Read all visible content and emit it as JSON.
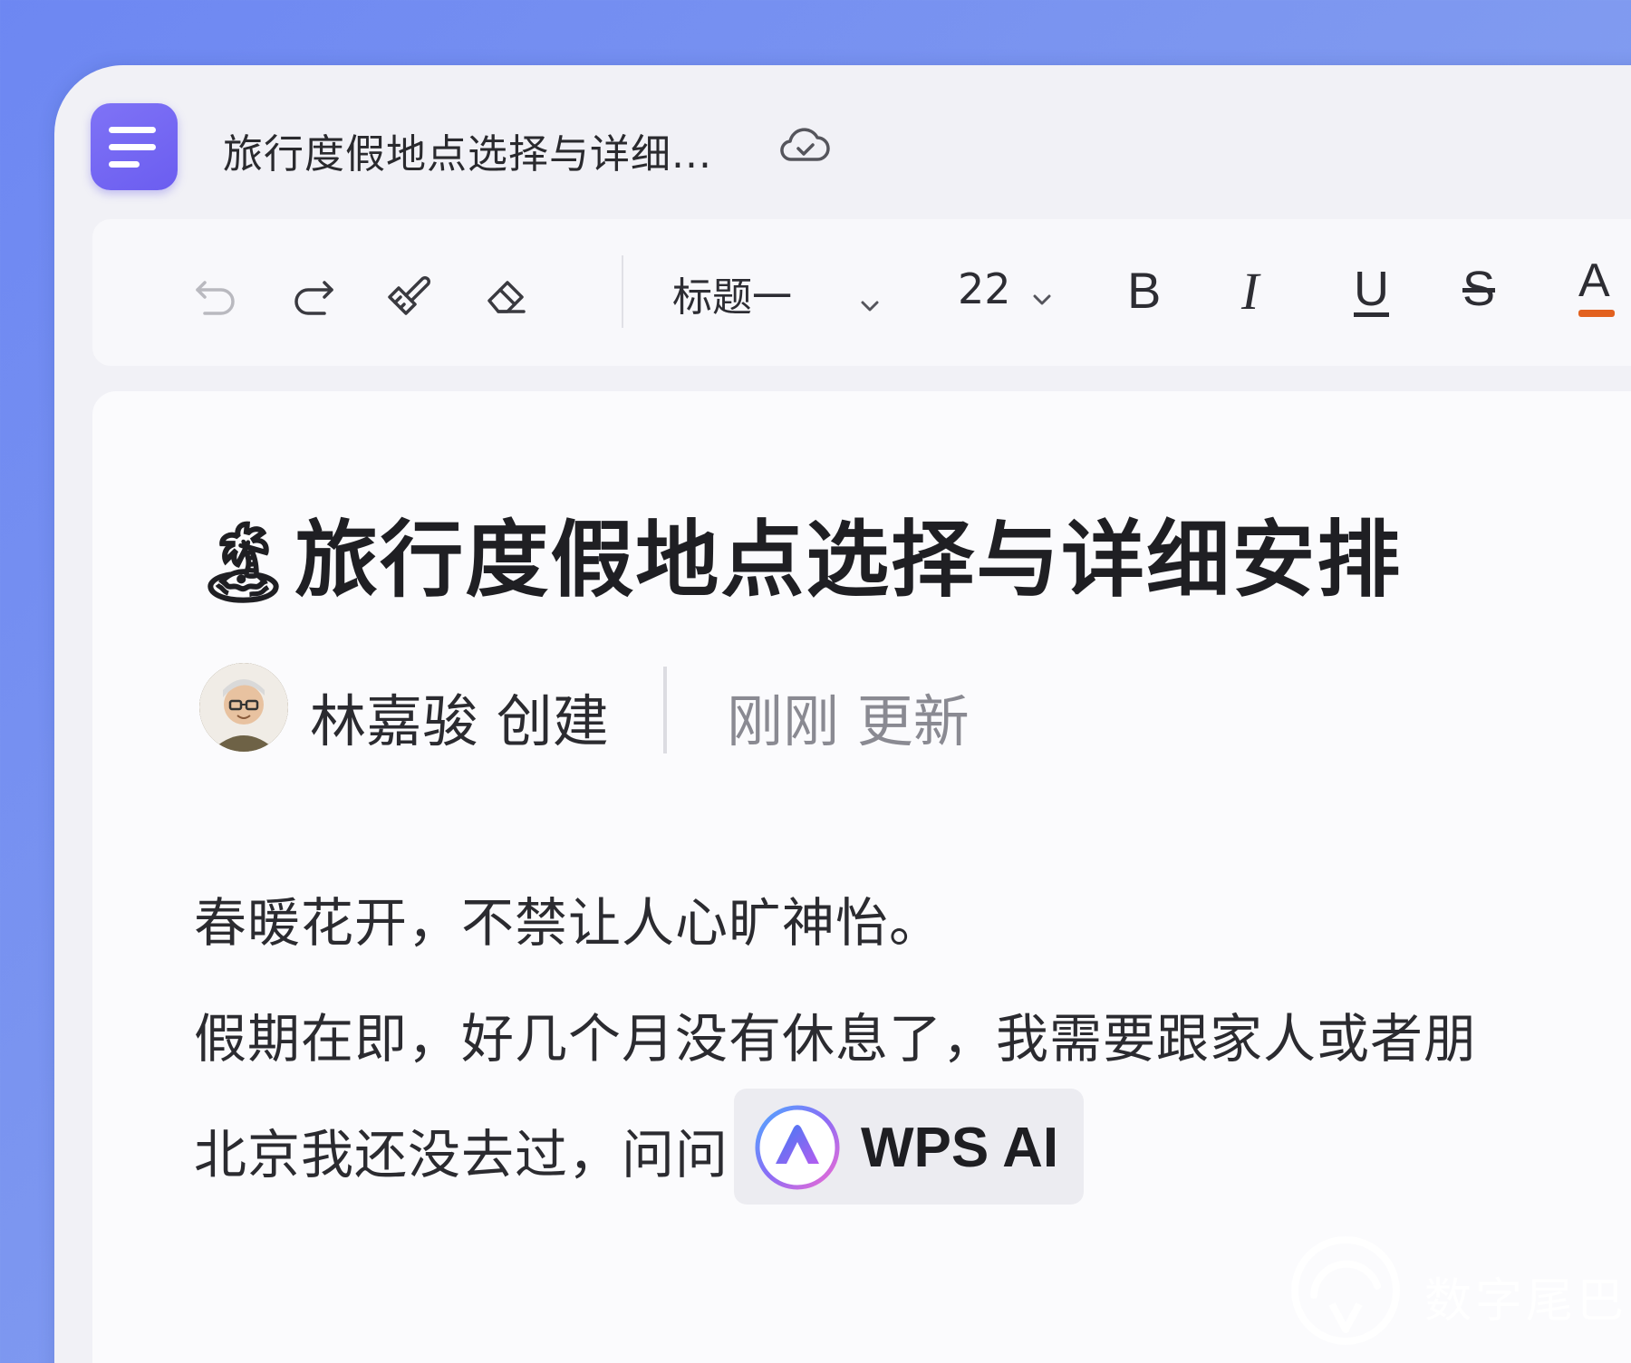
{
  "window": {
    "tab_title": "旅行度假地点选择与详细...",
    "app_icon": "document-lines-icon",
    "sync_icon": "cloud-check-icon"
  },
  "toolbar": {
    "undo_icon": "undo-icon",
    "redo_icon": "redo-icon",
    "format_painter_icon": "format-painter-icon",
    "eraser_icon": "eraser-icon",
    "paragraph_style": "标题一",
    "font_size": "22",
    "bold": "B",
    "italic": "I",
    "underline": "U",
    "strikethrough": "S",
    "font_color_letter": "A",
    "font_color": "#e2611f"
  },
  "document": {
    "title_emoji": "🏝",
    "title": "旅行度假地点选择与详细安排",
    "author": "林嘉骏 创建",
    "updated": "刚刚 更新",
    "paragraphs": [
      "春暖花开，不禁让人心旷神怡。",
      "假期在即，好几个月没有休息了，我需要跟家人或者朋",
      "北京我还没去过，问问"
    ],
    "ai_chip_label": "WPS AI"
  },
  "watermark": {
    "text": "数字尾巴"
  }
}
